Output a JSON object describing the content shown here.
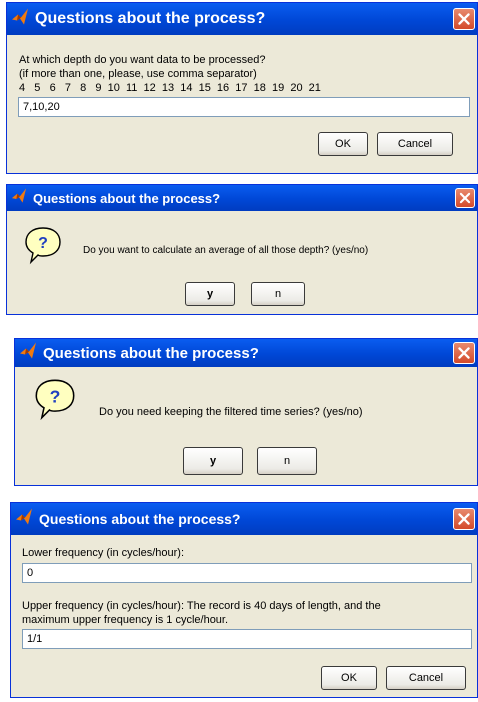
{
  "dialog1": {
    "title": "Questions about the process?",
    "prompt_line1": "At which depth do you want data to be processed?",
    "prompt_line2": "(if more than one, please, use comma separator)",
    "depths": "4   5   6   7   8   9  10  11  12  13  14  15  16  17  18  19  20  21",
    "input_value": "7,10,20",
    "ok_label": "OK",
    "cancel_label": "Cancel"
  },
  "dialog2": {
    "title": "Questions about the process?",
    "question": "Do you want to calculate an average of all those depth? (yes/no)",
    "yes_label": "y",
    "no_label": "n"
  },
  "dialog3": {
    "title": "Questions about the process?",
    "question": "Do you need keeping the filtered time series? (yes/no)",
    "yes_label": "y",
    "no_label": "n"
  },
  "dialog4": {
    "title": "Questions about the process?",
    "lower_label": "Lower frequency (in cycles/hour):",
    "lower_value": "0",
    "upper_label_line1": "Upper frequency (in cycles/hour):  The record is 40 days of length, and the",
    "upper_label_line2": "maximum upper frequency is 1 cycle/hour.",
    "upper_value": "1/1",
    "ok_label": "OK",
    "cancel_label": "Cancel"
  },
  "colors": {
    "titlebar": "#0047D6",
    "dialog_bg": "#ECE9D8",
    "close_button": "#D44A2A",
    "question_bubble": "#FFFFC0"
  },
  "icons": [
    "matlab-icon",
    "close-icon",
    "question-bubble-icon"
  ]
}
